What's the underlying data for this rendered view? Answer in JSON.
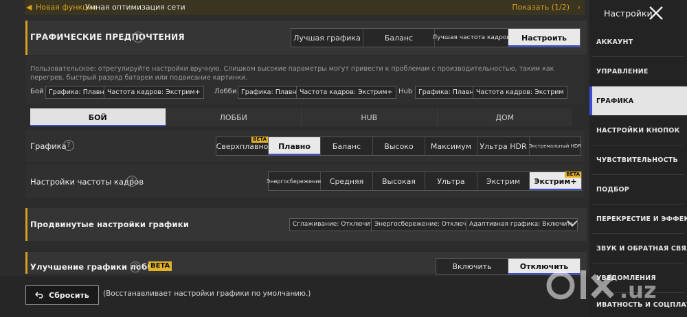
{
  "notification": {
    "new_label": "Новая функция",
    "text": "Умная оптимизация сети",
    "show_label": "Показать (1/2)"
  },
  "prefs": {
    "title": "ГРАФИЧЕСКИЕ ПРЕДПОЧТЕНИЯ",
    "options": [
      "Лучшая графика",
      "Баланс",
      "Лучшая частота кадров",
      "Настроить"
    ],
    "description": "Пользовательское: отрегулируйте настройки вручную. Слишком высокие параметры могут привести к проблемам с производительностью, таким как перегрев, быстрый разряд батареи или подвисание картинки.",
    "summary": [
      {
        "label": "Бой",
        "graphics": "Графика: Плавно",
        "fps": "Частота кадров: Экстрим+"
      },
      {
        "label": "Лобби",
        "graphics": "Графика: Плавно",
        "fps": "Частота кадров: Экстрим+"
      },
      {
        "label": "Hub",
        "graphics": "Графика: Плавно",
        "fps": "Частота кадров: Экстрим"
      }
    ]
  },
  "mode_tabs": [
    "БОЙ",
    "ЛОББИ",
    "HUB",
    "ДОМ"
  ],
  "graphics": {
    "label": "Графика",
    "options": [
      "Сверхплавно",
      "Плавно",
      "Баланс",
      "Высоко",
      "Максимум",
      "Ультра HDR",
      "Экстремальный HDR"
    ],
    "beta": "BETA"
  },
  "fps": {
    "label": "Настройки частоты кадров",
    "options": [
      "Энергосбережение",
      "Средняя",
      "Высокая",
      "Ультра",
      "Экстрим",
      "Экстрим+"
    ],
    "beta": "BETA"
  },
  "advanced": {
    "label": "Продвинутые настройки графики",
    "chips": [
      "Сглаживание: Отключить",
      "Энергосбережение: Отключить",
      "Адаптивная графика: Включить"
    ]
  },
  "lobby_enh": {
    "label": "Улучшение графики лобби",
    "beta": "BETA",
    "options": [
      "Включить",
      "Отключить"
    ]
  },
  "reset": {
    "label": "Сбросить",
    "description": "(Восстанавливает настройки графики по умолчанию.)"
  },
  "sidebar": {
    "title": "Настройки",
    "items": [
      "АККАУНТ",
      "УПРАВЛЕНИЕ",
      "ГРАФИКА",
      "НАСТРОЙКИ КНОПОК",
      "ЧУВСТВИТЕЛЬНОСТЬ",
      "ПОДБОР",
      "ПЕРЕКРЕСТИЕ И ЭФФЕКТЫ",
      "ЗВУК И ОБРАТНАЯ СВЯЗЬ",
      "УВЕДОМЛЕНИЯ",
      "ИВАТНОСТЬ И СОЦПЛАТФОРМЫ"
    ]
  },
  "watermark": "olx.uz",
  "colors": {
    "accent": "#d8a021",
    "selected_underline": "#3a4bd4",
    "beta": "#e4b228"
  }
}
